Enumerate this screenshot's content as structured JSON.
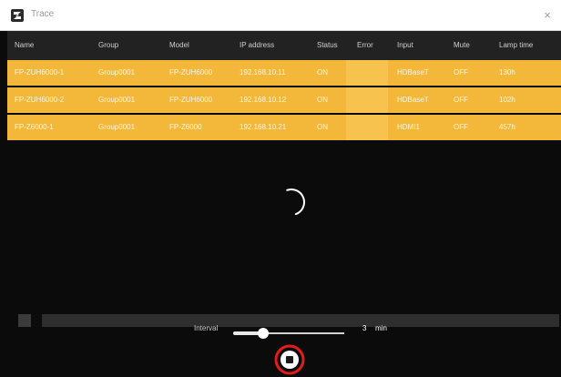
{
  "window": {
    "title": "Trace",
    "close_glyph": "×",
    "app_icon": "app-logo-icon",
    "close_icon": "close-icon"
  },
  "table": {
    "columns": [
      "Name",
      "Group",
      "Model",
      "IP address",
      "Status",
      "Error",
      "Input",
      "Mute",
      "Lamp time"
    ],
    "rows": [
      [
        "FP-ZUH6000-1",
        "Group0001",
        "FP-ZUH6000",
        "192.168.10.11",
        "ON",
        "",
        "HDBaseT",
        "OFF",
        "130h"
      ],
      [
        "FP-ZUH6000-2",
        "Group0001",
        "FP-ZUH6000",
        "192.168.10.12",
        "ON",
        "",
        "HDBaseT",
        "OFF",
        "102h"
      ],
      [
        "FP-Z6000-1",
        "Group0001",
        "FP-Z6000",
        "192.168.10.21",
        "ON",
        "",
        "HDMI1",
        "OFF",
        "457h"
      ]
    ],
    "row_color": "#f3b73a",
    "header_color": "#222222"
  },
  "status": {
    "spinner_icon": "loading-spinner-icon"
  },
  "controls": {
    "interval_label": "Interval",
    "interval_value": "3",
    "interval_unit": "min",
    "interval_fraction": 0.27,
    "progress_fraction": 0.0,
    "stop_icon": "stop-icon",
    "highlight_color": "#e21b1b"
  }
}
